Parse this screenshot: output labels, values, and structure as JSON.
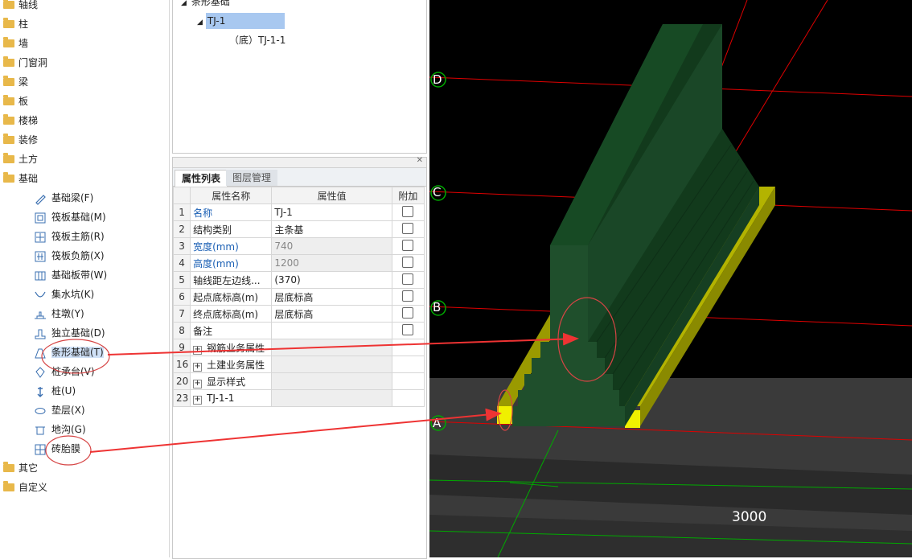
{
  "nav": {
    "items": [
      {
        "label": "轴线"
      },
      {
        "label": "柱"
      },
      {
        "label": "墙"
      },
      {
        "label": "门窗洞"
      },
      {
        "label": "梁"
      },
      {
        "label": "板"
      },
      {
        "label": "楼梯"
      },
      {
        "label": "装修"
      },
      {
        "label": "土方"
      },
      {
        "label": "基础"
      }
    ],
    "foundation_children": [
      {
        "label": "基础梁(F)",
        "icon": "beam-icon"
      },
      {
        "label": "筏板基础(M)",
        "icon": "raft-icon"
      },
      {
        "label": "筏板主筋(R)",
        "icon": "raft-main-rebar-icon"
      },
      {
        "label": "筏板负筋(X)",
        "icon": "raft-neg-rebar-icon"
      },
      {
        "label": "基础板带(W)",
        "icon": "slab-strip-icon"
      },
      {
        "label": "集水坑(K)",
        "icon": "sump-icon"
      },
      {
        "label": "柱墩(Y)",
        "icon": "column-pier-icon"
      },
      {
        "label": "独立基础(D)",
        "icon": "isolated-footing-icon"
      },
      {
        "label": "条形基础(T)",
        "icon": "strip-footing-icon"
      },
      {
        "label": "桩承台(V)",
        "icon": "pile-cap-icon"
      },
      {
        "label": "桩(U)",
        "icon": "pile-icon"
      },
      {
        "label": "垫层(X)",
        "icon": "cushion-icon"
      },
      {
        "label": "地沟(G)",
        "icon": "trench-icon"
      },
      {
        "label": "砖胎膜",
        "icon": "brick-mold-icon"
      }
    ],
    "bottom_items": [
      {
        "label": "其它"
      },
      {
        "label": "自定义"
      }
    ]
  },
  "tree": {
    "root": "条形基础",
    "node": "TJ-1",
    "leaf": "（底）TJ-1-1"
  },
  "props": {
    "tab_active": "属性列表",
    "tab_inactive": "图层管理",
    "headers": [
      "属性名称",
      "属性值",
      "附加"
    ],
    "rows": [
      {
        "num": "1",
        "name": "名称",
        "value": "TJ-1"
      },
      {
        "num": "2",
        "name": "结构类别",
        "value": "主条基"
      },
      {
        "num": "3",
        "name": "宽度(mm)",
        "value": "740"
      },
      {
        "num": "4",
        "name": "高度(mm)",
        "value": "1200"
      },
      {
        "num": "5",
        "name": "轴线距左边线...",
        "value": "(370)"
      },
      {
        "num": "6",
        "name": "起点底标高(m)",
        "value": "层底标高"
      },
      {
        "num": "7",
        "name": "终点底标高(m)",
        "value": "层底标高"
      },
      {
        "num": "8",
        "name": "备注",
        "value": ""
      },
      {
        "num": "9",
        "name": "钢筋业务属性",
        "value": ""
      },
      {
        "num": "16",
        "name": "土建业务属性",
        "value": ""
      },
      {
        "num": "20",
        "name": "显示样式",
        "value": ""
      },
      {
        "num": "23",
        "name": "TJ-1-1",
        "value": ""
      }
    ]
  },
  "view": {
    "axis_labels": [
      "D",
      "C",
      "B",
      "A"
    ],
    "dimension": "3000",
    "colors": {
      "footing": "#1f4f2c",
      "cushion": "#e4e400",
      "grid_red": "#e00000",
      "grid_green": "#00aa00"
    }
  }
}
